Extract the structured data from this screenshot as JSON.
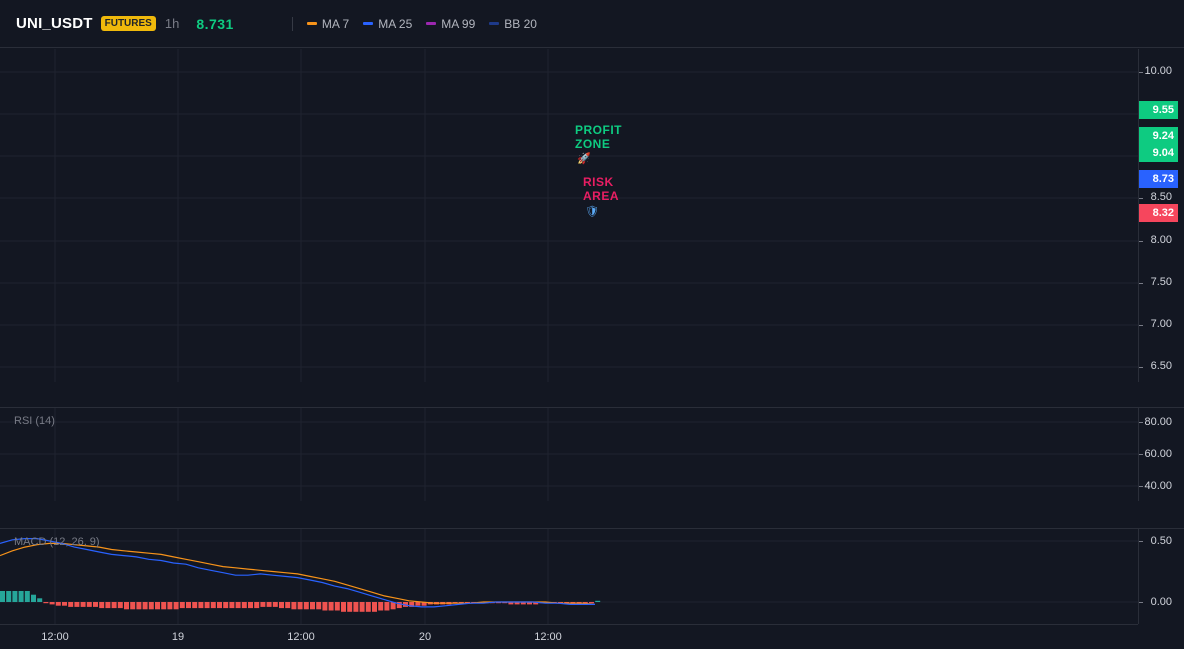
{
  "header": {
    "symbol": "UNI_USDT",
    "badge": "FUTURES",
    "interval": "1h",
    "last_price": "8.731",
    "indicators": [
      {
        "label": "MA 7",
        "color": "#f7931a"
      },
      {
        "label": "MA 25",
        "color": "#2962ff"
      },
      {
        "label": "MA 99",
        "color": "#9c27b0"
      },
      {
        "label": "BB 20",
        "color": "#1e3a8a"
      }
    ]
  },
  "main_pane": {
    "price_axis": [
      "10.00",
      "8.50",
      "8.00",
      "7.50",
      "7.00",
      "6.50"
    ],
    "price_tags": [
      {
        "value": "9.55",
        "color": "#0ecb81"
      },
      {
        "value": "9.24",
        "color": "#0ecb81"
      },
      {
        "value": "9.04",
        "color": "#0ecb81"
      },
      {
        "value": "8.73",
        "color": "#2962ff"
      },
      {
        "value": "8.32",
        "color": "#f6465d"
      }
    ],
    "annotations": {
      "profit_line1": "PROFIT",
      "profit_line2": "ZONE",
      "profit_icon": "🚀",
      "risk_line1": "RISK",
      "risk_line2": "AREA",
      "risk_icon": "🛡"
    }
  },
  "rsi_pane": {
    "title": "RSI (14)",
    "axis": [
      "80.00",
      "60.00",
      "40.00"
    ]
  },
  "macd_pane": {
    "title": "MACD (12, 26, 9)",
    "axis": [
      "0.50",
      "0.00"
    ],
    "histogram": [
      0.09,
      0.09,
      0.09,
      0.09,
      0.09,
      0.06,
      0.03,
      -0.01,
      -0.02,
      -0.03,
      -0.03,
      -0.04,
      -0.04,
      -0.04,
      -0.04,
      -0.04,
      -0.05,
      -0.05,
      -0.05,
      -0.05,
      -0.06,
      -0.06,
      -0.06,
      -0.06,
      -0.06,
      -0.06,
      -0.06,
      -0.06,
      -0.06,
      -0.05,
      -0.05,
      -0.05,
      -0.05,
      -0.05,
      -0.05,
      -0.05,
      -0.05,
      -0.05,
      -0.05,
      -0.05,
      -0.05,
      -0.05,
      -0.04,
      -0.04,
      -0.04,
      -0.05,
      -0.05,
      -0.06,
      -0.06,
      -0.06,
      -0.06,
      -0.06,
      -0.07,
      -0.07,
      -0.07,
      -0.08,
      -0.08,
      -0.08,
      -0.08,
      -0.08,
      -0.08,
      -0.07,
      -0.07,
      -0.06,
      -0.05,
      -0.04,
      -0.04,
      -0.03,
      -0.03,
      -0.02,
      -0.02,
      -0.02,
      -0.02,
      -0.01,
      -0.01,
      -0.01,
      -0.01,
      -0.01,
      -0.01,
      -0.01,
      -0.01,
      -0.01,
      -0.02,
      -0.02,
      -0.02,
      -0.02,
      -0.02,
      -0.01,
      -0.01,
      -0.01,
      -0.01,
      -0.01,
      -0.02,
      -0.02,
      -0.02,
      -0.01,
      0.01
    ],
    "macd_line": [
      0.48,
      0.51,
      0.52,
      0.52,
      0.5,
      0.48,
      0.45,
      0.43,
      0.41,
      0.39,
      0.38,
      0.37,
      0.35,
      0.34,
      0.32,
      0.31,
      0.28,
      0.26,
      0.24,
      0.22,
      0.22,
      0.23,
      0.22,
      0.21,
      0.2,
      0.18,
      0.16,
      0.13,
      0.11,
      0.08,
      0.05,
      0.02,
      -0.01,
      -0.03,
      -0.04,
      -0.04,
      -0.03,
      -0.02,
      -0.01,
      -0.01,
      0.0,
      0.0,
      0.0,
      0.0,
      -0.01,
      -0.01,
      -0.02,
      -0.02,
      -0.02
    ],
    "signal_line": [
      0.38,
      0.42,
      0.45,
      0.47,
      0.48,
      0.48,
      0.47,
      0.46,
      0.45,
      0.43,
      0.42,
      0.41,
      0.4,
      0.39,
      0.37,
      0.35,
      0.33,
      0.31,
      0.29,
      0.28,
      0.27,
      0.26,
      0.25,
      0.24,
      0.23,
      0.21,
      0.19,
      0.17,
      0.14,
      0.11,
      0.08,
      0.05,
      0.03,
      0.01,
      0.0,
      -0.01,
      -0.01,
      -0.01,
      -0.01,
      0.0,
      0.0,
      0.0,
      0.0,
      0.0,
      0.0,
      -0.01,
      -0.01,
      -0.01,
      -0.02
    ]
  },
  "time_axis": [
    "12:00",
    "19",
    "12:00",
    "20",
    "12:00"
  ]
}
